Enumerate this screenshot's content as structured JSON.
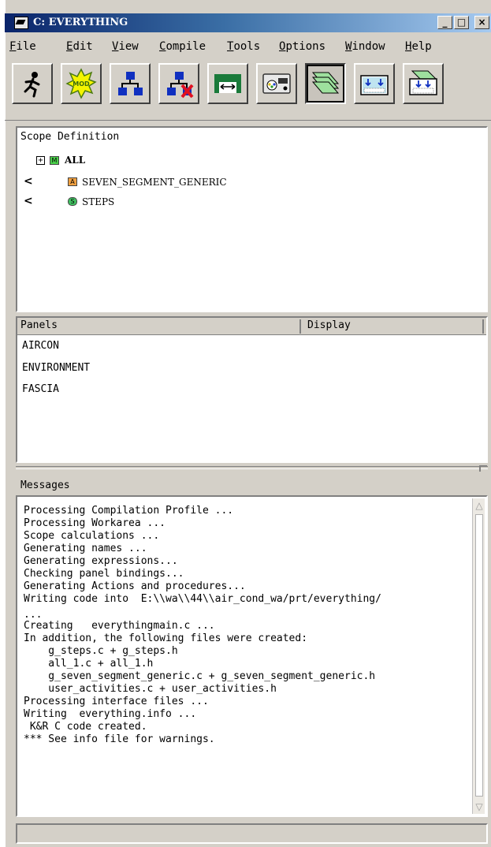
{
  "window": {
    "title": "C: EVERYTHING",
    "minimize": "_",
    "maximize": "□",
    "close": "×"
  },
  "menu": [
    "File",
    "Edit",
    "View",
    "Compile",
    "Tools",
    "Options",
    "Window",
    "Help"
  ],
  "toolbar": {
    "buttons": [
      {
        "icon": "running-man-icon"
      },
      {
        "icon": "mod-burst-icon",
        "label": "MOD"
      },
      {
        "icon": "hierarchy-icon"
      },
      {
        "icon": "hierarchy-delete-icon"
      },
      {
        "icon": "panel-transfer-icon"
      },
      {
        "icon": "gauge-panel-icon"
      },
      {
        "icon": "stacked-pages-icon",
        "pressed": true
      },
      {
        "icon": "import-panel-icon"
      },
      {
        "icon": "export-panel-icon"
      }
    ]
  },
  "scope": {
    "label": "Scope Definition",
    "items": [
      {
        "expander": "+",
        "badge": "M",
        "name": "ALL",
        "badge_color": "#4ad04a"
      },
      {
        "marker": "<",
        "badge": "A",
        "name": "SEVEN_SEGMENT_GENERIC",
        "badge_color": "#f0a040"
      },
      {
        "marker": "<",
        "badge": "S",
        "name": "STEPS",
        "badge_color": "#40c060"
      }
    ]
  },
  "panels": {
    "columns": [
      "Panels",
      "Display"
    ],
    "rows": [
      "AIRCON",
      "ENVIRONMENT",
      "FASCIA"
    ]
  },
  "messages": {
    "label": "Messages",
    "lines": [
      "Processing Compilation Profile ...",
      "Processing Workarea ...",
      "Scope calculations ...",
      "Generating names ...",
      "Generating expressions...",
      "Checking panel bindings...",
      "Generating Actions and procedures...",
      "Writing code into  E:\\\\wa\\\\44\\\\air_cond_wa/prt/everything/",
      "...",
      "Creating   everythingmain.c ...",
      "In addition, the following files were created:",
      "    g_steps.c + g_steps.h",
      "    all_1.c + all_1.h",
      "    g_seven_segment_generic.c + g_seven_segment_generic.h",
      "    user_activities.c + user_activities.h",
      "Processing interface files ...",
      "Writing  everything.info ...",
      " K&R C code created.",
      "*** See info file for warnings."
    ]
  },
  "status": {
    "text": ""
  }
}
